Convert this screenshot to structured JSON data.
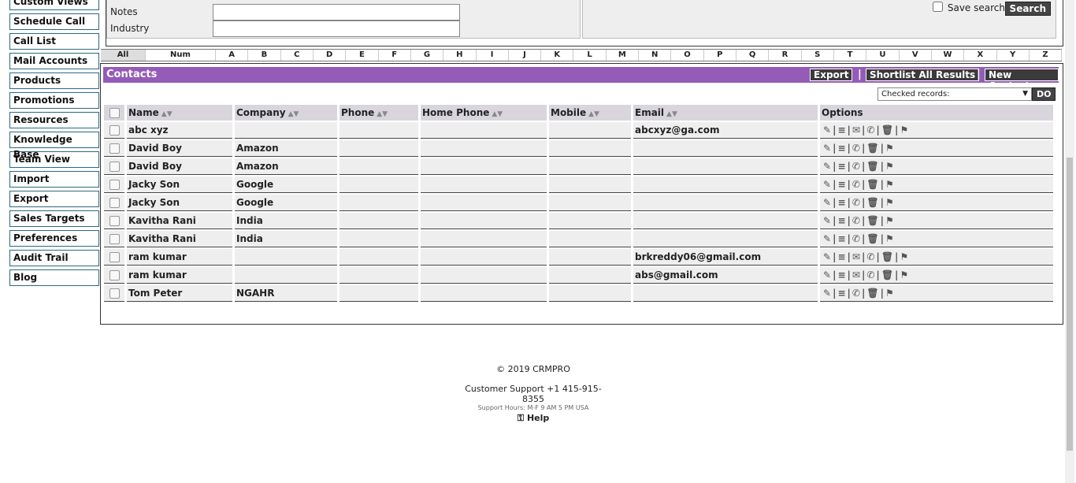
{
  "sidebar": {
    "items": [
      "Custom Views",
      "Schedule Call",
      "Call List",
      "Mail Accounts",
      "Products",
      "Promotions",
      "Resources",
      "Knowledge Base",
      "Team View",
      "Import",
      "Export",
      "Sales Targets",
      "Preferences",
      "Audit Trail",
      "Blog"
    ]
  },
  "search": {
    "notes_label": "Notes",
    "industry_label": "Industry",
    "notes_value": "",
    "industry_value": "",
    "save_search_label": "Save search",
    "search_button": "Search"
  },
  "alphabet": [
    "All",
    "Num",
    "A",
    "B",
    "C",
    "D",
    "E",
    "F",
    "G",
    "H",
    "I",
    "J",
    "K",
    "L",
    "M",
    "N",
    "O",
    "P",
    "Q",
    "R",
    "S",
    "T",
    "U",
    "V",
    "W",
    "X",
    "Y",
    "Z"
  ],
  "contacts": {
    "title": "Contacts",
    "export_button": "Export",
    "shortlist_button": "Shortlist All Results",
    "new_contact_button": "New Contact",
    "separator": "|",
    "bulk_select_value": "Checked records:",
    "do_button": "DO",
    "columns": [
      "Name",
      "Company",
      "Phone",
      "Home Phone",
      "Mobile",
      "Email",
      "Options"
    ],
    "sort_glyph": "▲▼",
    "rows": [
      {
        "name": "abc xyz",
        "company": "",
        "phone": "",
        "home": "",
        "mobile": "",
        "email": "abcxyz@ga.com"
      },
      {
        "name": "David Boy",
        "company": "Amazon",
        "phone": "",
        "home": "",
        "mobile": "",
        "email": ""
      },
      {
        "name": "David Boy",
        "company": "Amazon",
        "phone": "",
        "home": "",
        "mobile": "",
        "email": ""
      },
      {
        "name": "Jacky Son",
        "company": "Google",
        "phone": "",
        "home": "",
        "mobile": "",
        "email": ""
      },
      {
        "name": "Jacky Son",
        "company": "Google",
        "phone": "",
        "home": "",
        "mobile": "",
        "email": ""
      },
      {
        "name": "Kavitha Rani",
        "company": "India",
        "phone": "",
        "home": "",
        "mobile": "",
        "email": ""
      },
      {
        "name": "Kavitha Rani",
        "company": "India",
        "phone": "",
        "home": "",
        "mobile": "",
        "email": ""
      },
      {
        "name": "ram kumar",
        "company": "",
        "phone": "",
        "home": "",
        "mobile": "",
        "email": "brkreddy06@gmail.com"
      },
      {
        "name": "ram kumar",
        "company": "",
        "phone": "",
        "home": "",
        "mobile": "",
        "email": "abs@gmail.com"
      },
      {
        "name": "Tom Peter",
        "company": "NGAHR",
        "phone": "",
        "home": "",
        "mobile": "",
        "email": ""
      }
    ]
  },
  "footer": {
    "copyright": "© 2019 CRMPRO",
    "support": "Customer Support +1 415-915-8355",
    "hours": "Support Hours: M-F 9 AM 5 PM USA",
    "help": "Help"
  },
  "colors": {
    "header_purple": "#945cb8",
    "button_dark": "#3b3b3b",
    "sidebar_border": "#2b6a7e"
  },
  "icons": [
    "edit-icon",
    "list-icon",
    "mail-icon",
    "phone-icon",
    "trash-icon",
    "flag-icon",
    "help-icon"
  ]
}
